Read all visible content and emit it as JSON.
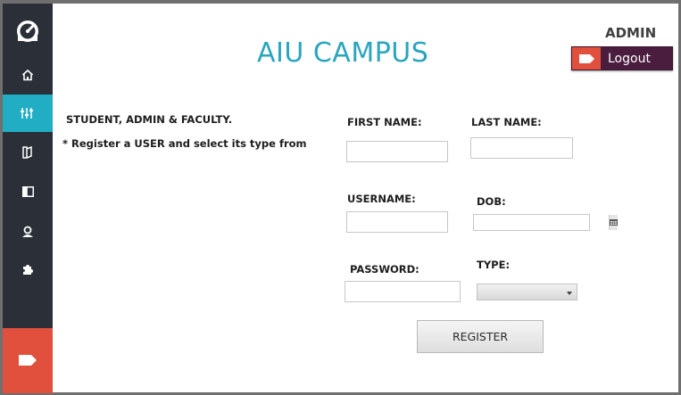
{
  "header": {
    "title": "AIU CAMPUS",
    "role": "ADMIN",
    "logout_label": "Logout"
  },
  "sidebar": {
    "items": [
      {
        "icon": "dashboard-logo-icon"
      },
      {
        "icon": "home-icon"
      },
      {
        "icon": "sliders-icon",
        "active": true
      },
      {
        "icon": "book-icon"
      },
      {
        "icon": "panel-icon"
      },
      {
        "icon": "user-icon"
      },
      {
        "icon": "puzzle-icon"
      }
    ],
    "exit_icon": "exit-tag-icon"
  },
  "info": {
    "line1": "STUDENT, ADMIN & FACULTY.",
    "line2": "* Register a USER and select its type from"
  },
  "form": {
    "first_name": {
      "label": "FIRST NAME:",
      "value": ""
    },
    "last_name": {
      "label": "LAST NAME:",
      "value": ""
    },
    "username": {
      "label": "USERNAME:",
      "value": ""
    },
    "dob": {
      "label": "DOB:",
      "value": ""
    },
    "password": {
      "label": "PASSWORD:",
      "value": ""
    },
    "type": {
      "label": "TYPE:",
      "value": ""
    },
    "register_label": "REGISTER"
  },
  "colors": {
    "accent": "#2aa5bf",
    "sidebar": "#2b2f38",
    "active": "#21aec4",
    "danger": "#e0503d",
    "logout_bg": "#4a1d3e"
  }
}
